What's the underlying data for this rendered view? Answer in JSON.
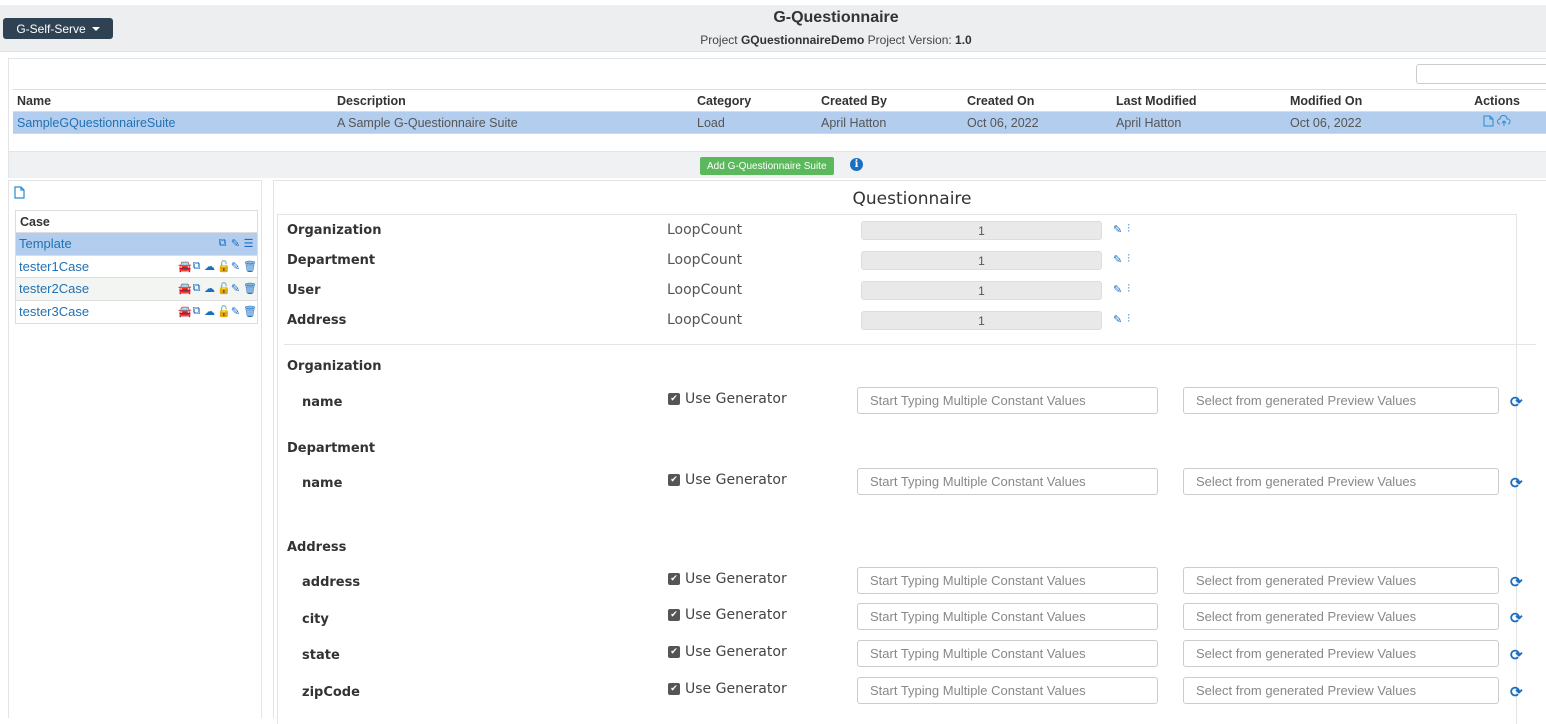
{
  "header": {
    "menu_button": "G-Self-Serve",
    "app_title": "G-Questionnaire",
    "project_prefix": "Project",
    "project_name": "GQuestionnaireDemo",
    "version_prefix": "Project Version:",
    "version": "1.0"
  },
  "suite_table": {
    "columns": [
      "Name",
      "Description",
      "Category",
      "Created By",
      "Created On",
      "Last Modified",
      "Modified On",
      "Actions"
    ],
    "rows": [
      [
        "SampleGQuestionnaireSuite",
        "A Sample G-Questionnaire Suite",
        "Load",
        "April Hatton",
        "Oct 06, 2022",
        "April Hatton",
        "Oct 06, 2022"
      ]
    ],
    "add_button": "Add G-Questionnaire Suite"
  },
  "cases": {
    "header": "Case",
    "items": [
      "Template",
      "tester1Case",
      "tester2Case",
      "tester3Case"
    ]
  },
  "questionnaire": {
    "title": "Questionnaire",
    "loop_rows": [
      {
        "label": "Organization",
        "name": "LoopCount",
        "value": "1"
      },
      {
        "label": "Department",
        "name": "LoopCount",
        "value": "1"
      },
      {
        "label": "User",
        "name": "LoopCount",
        "value": "1"
      },
      {
        "label": "Address",
        "name": "LoopCount",
        "value": "1"
      }
    ],
    "generator_label": "Use Generator",
    "const_placeholder": "Start Typing Multiple Constant Values",
    "preview_placeholder": "Select from generated Preview Values",
    "sections": [
      {
        "title": "Organization",
        "fields": [
          "name"
        ]
      },
      {
        "title": "Department",
        "fields": [
          "name"
        ]
      },
      {
        "title": "Address",
        "fields": [
          "address",
          "city",
          "state",
          "zipCode"
        ]
      }
    ]
  },
  "colors": {
    "accent": "#1a6fc2",
    "selected_row": "#b3cdee",
    "add_button": "#5cb85c",
    "menu_button": "#2f4254"
  }
}
